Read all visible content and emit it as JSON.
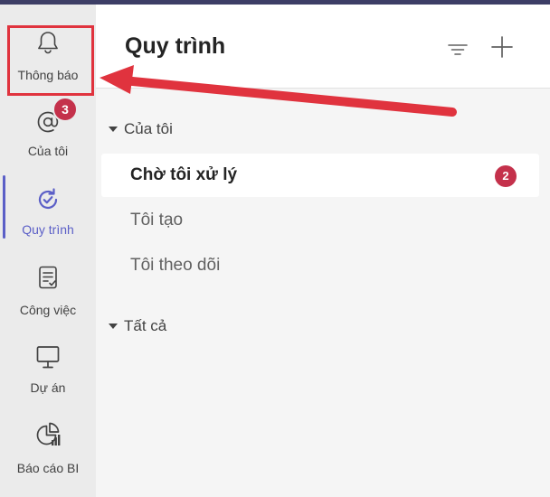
{
  "sidebar": {
    "items": [
      {
        "label": "Thông báo",
        "icon": "bell-icon"
      },
      {
        "label": "Của tôi",
        "icon": "mention-icon",
        "badge": "3"
      },
      {
        "label": "Quy trình",
        "icon": "workflow-icon",
        "active": true
      },
      {
        "label": "Công việc",
        "icon": "task-list-icon"
      },
      {
        "label": "Dự án",
        "icon": "presentation-board-icon"
      },
      {
        "label": "Báo cáo BI",
        "icon": "report-chart-icon"
      }
    ]
  },
  "panel": {
    "title": "Quy trình",
    "filter_icon": "filter-icon",
    "add_icon": "plus-icon",
    "sections": [
      {
        "label": "Của tôi",
        "items": [
          {
            "label": "Chờ tôi xử lý",
            "count": "2",
            "selected": true
          },
          {
            "label": "Tôi tạo"
          },
          {
            "label": "Tôi theo dõi"
          }
        ]
      },
      {
        "label": "Tất cả"
      }
    ]
  },
  "colors": {
    "accent": "#5b5fc7",
    "badge": "#c4314b",
    "annotation": "#e0333e",
    "topbar": "#3d3e66"
  }
}
